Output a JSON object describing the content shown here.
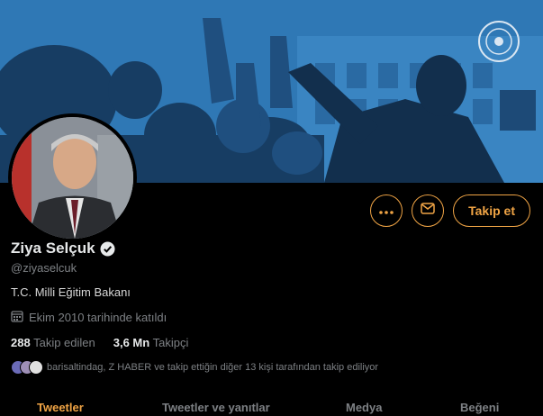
{
  "profile": {
    "name": "Ziya Selçuk",
    "handle": "@ziyaselcuk",
    "bio": "T.C. Milli Eğitim Bakanı",
    "joined": "Ekim 2010 tarihinde katıldı",
    "following_count": "288",
    "following_label": "Takip edilen",
    "followers_count": "3,6 Mn",
    "followers_label": "Takipçi",
    "followed_by": "barisaltindag, Z HABER ve takip ettiğin diğer 13 kişi tarafından takip ediliyor",
    "verified": true
  },
  "actions": {
    "more_icon": "more-dots-icon",
    "message_icon": "envelope-icon",
    "follow_label": "Takip et"
  },
  "tabs": [
    {
      "label": "Tweetler",
      "active": true
    },
    {
      "label": "Tweetler ve yanıtlar",
      "active": false
    },
    {
      "label": "Medya",
      "active": false
    },
    {
      "label": "Beğeni",
      "active": false
    }
  ],
  "colors": {
    "accent": "#f0a445",
    "banner": "#2f78b5",
    "background": "#000000",
    "muted_text": "#7d8084"
  }
}
